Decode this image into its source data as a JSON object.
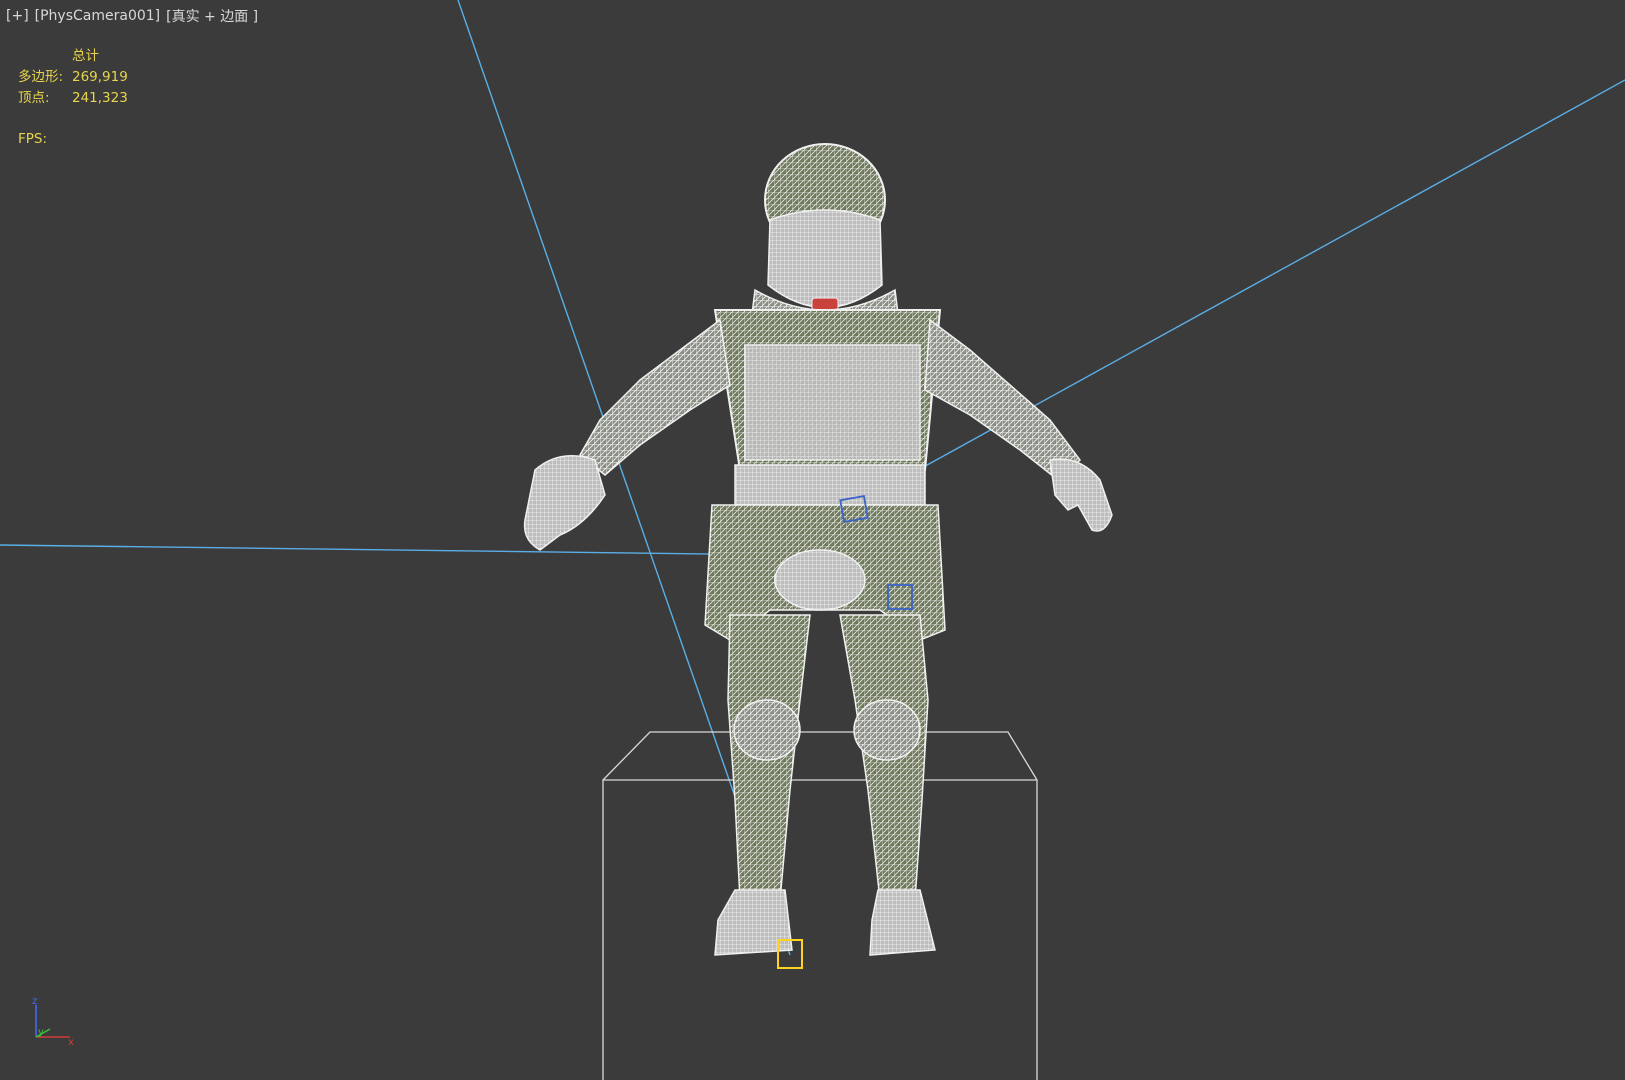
{
  "viewport": {
    "label_plus": "[+]",
    "label_camera": "[PhysCamera001]",
    "label_shading": "[真实 + 边面 ]"
  },
  "stats": {
    "header": "总计",
    "polygons_label": "多边形:",
    "polygons_value": "269,919",
    "vertices_label": "顶点:",
    "vertices_value": "241,323",
    "fps_label": "FPS:"
  },
  "axis_gizmo": {
    "z": "z",
    "y": "y",
    "x": "x"
  },
  "colors": {
    "background": "#3b3b3b",
    "stats_text": "#e8d44d",
    "camera_lines": "#5aaee6",
    "wireframe": "#e6e6e6",
    "selection_box": "#ffd21f"
  }
}
